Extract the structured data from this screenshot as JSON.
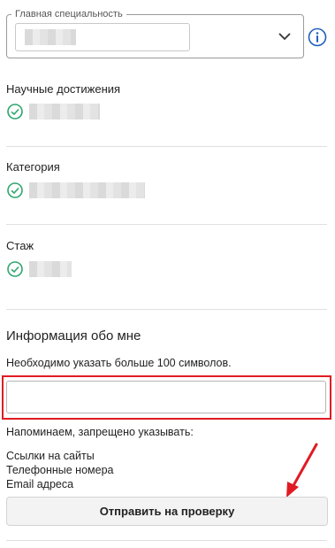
{
  "main_specialty": {
    "legend": "Главная специальность"
  },
  "fields": [
    {
      "label": "Научные достижения"
    },
    {
      "label": "Категория"
    },
    {
      "label": "Стаж"
    }
  ],
  "about": {
    "title": "Информация обо мне",
    "hint": "Необходимо указать больше 100 символов.",
    "textarea_value": "",
    "reminder": "Напоминаем, запрещено указывать:",
    "forbidden": [
      "Ссылки на сайты",
      "Телефонные номера",
      "Email адреса"
    ]
  },
  "submit_label": "Отправить на проверку",
  "icons": {
    "chevron": "chevron-down-icon",
    "info": "info-icon",
    "check": "check-circle-icon",
    "annotation_arrow": "red-arrow-icon"
  },
  "colors": {
    "accent_green": "#2ea66f",
    "info_blue": "#1f5fbf",
    "highlight_red": "#e01b24"
  }
}
